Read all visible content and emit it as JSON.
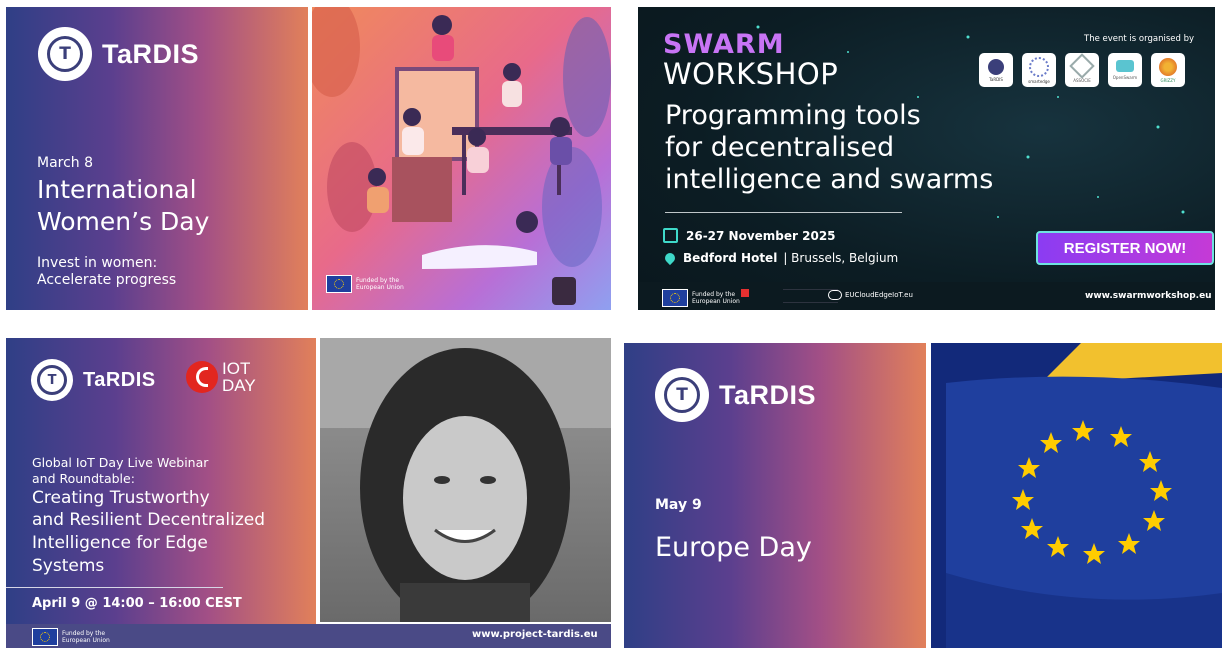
{
  "card1": {
    "brand": "TaRDIS",
    "date": "March 8",
    "title_line1": "International",
    "title_line2": "Women’s Day",
    "sub_line1": "Invest in women:",
    "sub_line2": "Accelerate progress",
    "funded": "Funded by the European Union"
  },
  "card2": {
    "swarm": "SWARM",
    "workshop": "WORKSHOP",
    "organised_by": "The event is organised by",
    "org_logos": [
      "TaRDIS",
      "smartedge",
      "ASSOCIE",
      "OpenSwarm",
      "GRIZZY"
    ],
    "title_line1": "Programming tools",
    "title_line2": "for decentralised",
    "title_line3": "intelligence and swarms",
    "dates": "26-27 November 2025",
    "venue": "Bedford Hotel",
    "city": "| Brussels, Belgium",
    "register": "REGISTER NOW!",
    "funded": "Funded by the European Union",
    "eucloud": "EUCloudEdgeIoT.eu",
    "url": "www.swarmworkshop.eu"
  },
  "card3": {
    "brand": "TaRDIS",
    "iot1": "IOT",
    "iot2": "DAY",
    "line1": "Global IoT Day Live Webinar",
    "line2": "and Roundtable:",
    "title1": "Creating Trustworthy",
    "title2": "and Resilient Decentralized",
    "title3": "Intelligence for Edge",
    "title4": "Systems",
    "when": "April 9 @ 14:00 – 16:00 CEST",
    "funded": "Funded by the European Union",
    "url": "www.project-tardis.eu"
  },
  "card4": {
    "brand": "TaRDIS",
    "date": "May 9",
    "title": "Europe Day"
  },
  "colors": {
    "grad_start": "#2f3f86",
    "grad_end": "#e1805a",
    "eu_blue": "#1f3f9e",
    "eu_yellow": "#ffcc00",
    "register": "#b93cf0"
  }
}
